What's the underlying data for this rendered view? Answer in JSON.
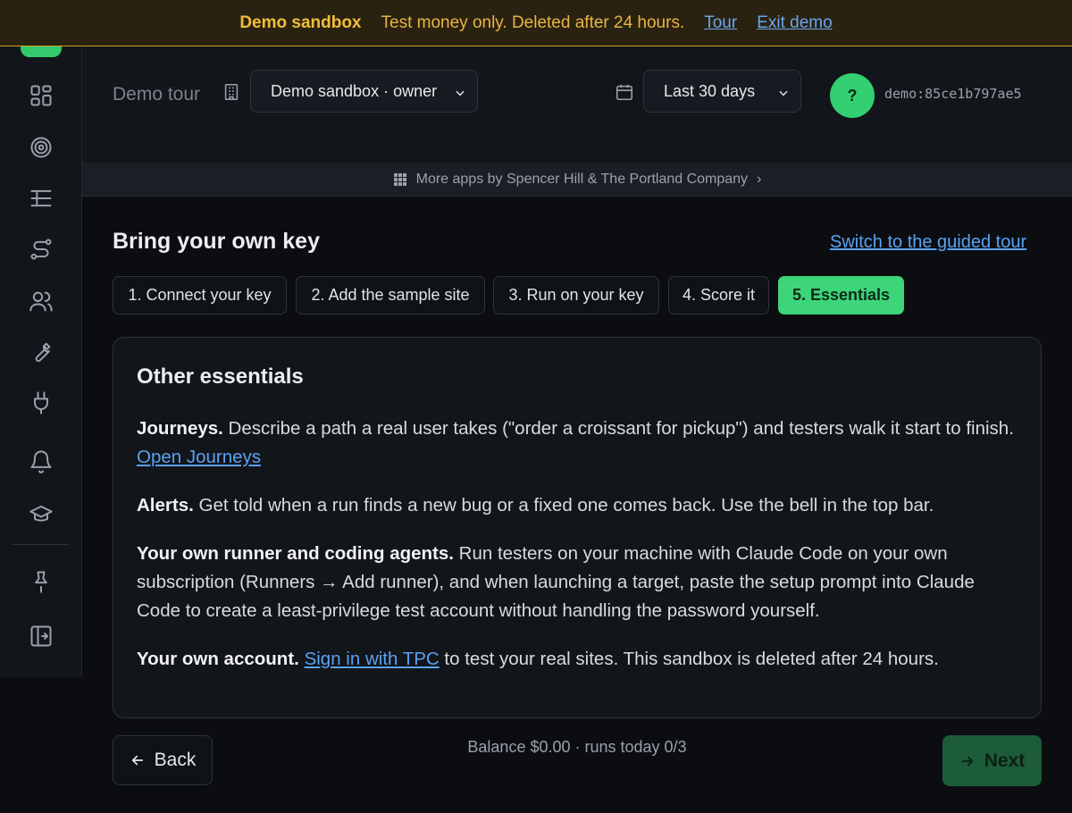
{
  "banner": {
    "title": "Demo sandbox",
    "text": "Test money only. Deleted after 24 hours.",
    "tour_link": "Tour",
    "exit_link": "Exit demo"
  },
  "sidebar": {
    "icons": [
      "dashboard-icon",
      "target-icon",
      "tree-list-icon",
      "route-icon",
      "users-icon",
      "wrench-icon",
      "plug-icon",
      "bell-icon",
      "graduation-cap-icon",
      "pin-icon",
      "sign-in-icon"
    ]
  },
  "header": {
    "page_label": "Demo tour",
    "org_select": "Demo sandbox · owner",
    "range_select": "Last 30 days",
    "avatar_initial": "?",
    "user_id": "demo:85ce1b797ae5"
  },
  "apps_strip": {
    "text": "More apps by Spencer Hill & The Portland Company",
    "chevron": "›"
  },
  "main": {
    "title": "Bring your own key",
    "guided_link": "Switch to the guided tour",
    "steps": [
      {
        "label": "1. Connect your key",
        "active": false
      },
      {
        "label": "2. Add the sample site",
        "active": false
      },
      {
        "label": "3. Run on your key",
        "active": false
      },
      {
        "label": "4. Score it",
        "active": false
      },
      {
        "label": "5. Essentials",
        "active": true
      }
    ],
    "card": {
      "title": "Other essentials",
      "journeys_label": "Journeys.",
      "journeys_text": " Describe a path a real user takes (\"order a croissant for pickup\") and testers walk it start to finish. ",
      "journeys_link": "Open Journeys",
      "alerts_label": "Alerts.",
      "alerts_text": " Get told when a run finds a new bug or a fixed one comes back. Use the bell in the top bar.",
      "runner_label": "Your own runner and coding agents.",
      "runner_text": " Run testers on your machine with Claude Code on your own subscription (Runners → Add runner), and when launching a target, paste the setup prompt into Claude Code to create a least-privilege test account without handling the password yourself.",
      "account_label": "Your own account.",
      "account_link": "Sign in with TPC",
      "account_text": " to test your real sites. This sandbox is deleted after 24 hours."
    },
    "back_label": "Back",
    "balance": "Balance $0.00 · runs today 0/3",
    "next_label": "Next"
  },
  "colors": {
    "accent": "#3ed47a",
    "banner_bg": "#2a2210",
    "banner_text": "#f2bf3a",
    "link": "#5aa2f2"
  }
}
